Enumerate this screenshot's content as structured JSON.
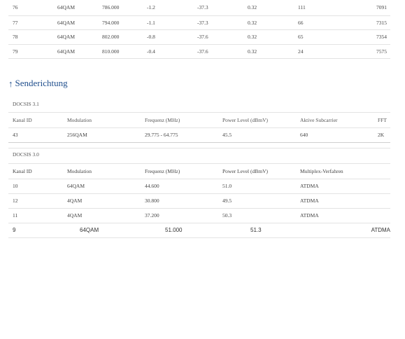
{
  "downstream_rows": [
    [
      "76",
      "64QAM",
      "786.000",
      "-1.2",
      "-37.3",
      "0.32",
      "111",
      "7091"
    ],
    [
      "77",
      "64QAM",
      "794.000",
      "-1.1",
      "-37.3",
      "0.32",
      "66",
      "7315"
    ],
    [
      "78",
      "64QAM",
      "802.000",
      "-0.8",
      "-37.6",
      "0.32",
      "65",
      "7354"
    ],
    [
      "79",
      "64QAM",
      "810.000",
      "-0.4",
      "-37.6",
      "0.32",
      "24",
      "7575"
    ]
  ],
  "upstream": {
    "title": "Senderichtung",
    "docsis31": {
      "label": "DOCSIS 3.1",
      "headers": [
        "Kanal ID",
        "Modulation",
        "Frequenz (MHz)",
        "Power Level (dBmV)",
        "Aktive Subcarrier",
        "FFT"
      ],
      "rows": [
        [
          "43",
          "256QAM",
          "29.775 - 64.775",
          "45.5",
          "640",
          "2K"
        ]
      ]
    },
    "docsis30": {
      "label": "DOCSIS 3.0",
      "headers": [
        "Kanal ID",
        "Modulation",
        "Frequenz (MHz)",
        "Power Level (dBmV)",
        "Multiplex-Verfahren"
      ],
      "rows": [
        [
          "10",
          "64QAM",
          "44.600",
          "51.0",
          "ATDMA"
        ],
        [
          "12",
          "4QAM",
          "30.800",
          "49.5",
          "ATDMA"
        ],
        [
          "11",
          "4QAM",
          "37.200",
          "50.3",
          "ATDMA"
        ]
      ],
      "last_row": [
        "9",
        "64QAM",
        "51.000",
        "51.3",
        "ATDMA"
      ]
    }
  },
  "icons": {
    "section_icon": "arrow-up-icon"
  },
  "colors": {
    "accent": "#1f4e8c"
  }
}
